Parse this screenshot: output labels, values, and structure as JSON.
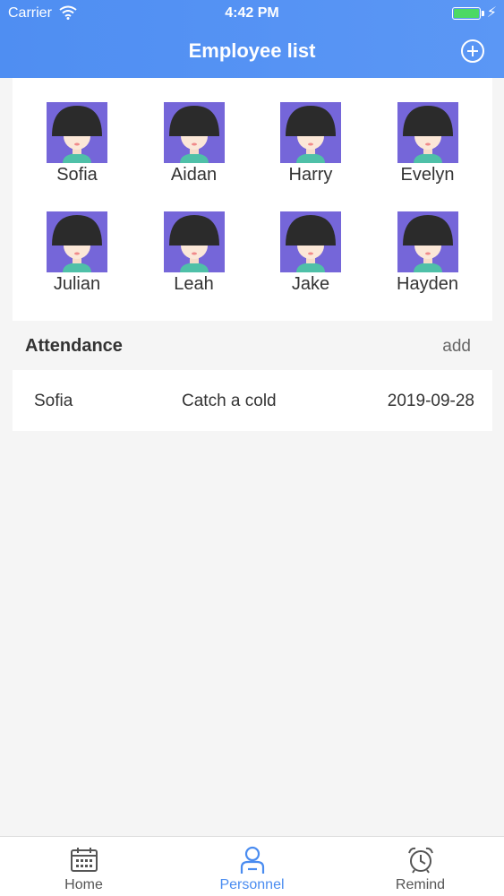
{
  "status_bar": {
    "carrier": "Carrier",
    "time": "4:42 PM"
  },
  "header": {
    "title": "Employee list"
  },
  "employees": [
    "Sofia",
    "Aidan",
    "Harry",
    "Evelyn",
    "Julian",
    "Leah",
    "Jake",
    "Hayden"
  ],
  "attendance": {
    "title": "Attendance",
    "add_label": "add",
    "rows": [
      {
        "name": "Sofia",
        "reason": "Catch a cold",
        "date": "2019-09-28"
      }
    ]
  },
  "tabs": [
    {
      "label": "Home",
      "icon": "calendar-icon",
      "active": false
    },
    {
      "label": "Personnel",
      "icon": "person-icon",
      "active": true
    },
    {
      "label": "Remind",
      "icon": "alarm-clock-icon",
      "active": false
    }
  ],
  "colors": {
    "accent": "#4f8ef2",
    "avatar_bg": "#7566d9",
    "active_tab": "#4a8cf0"
  }
}
